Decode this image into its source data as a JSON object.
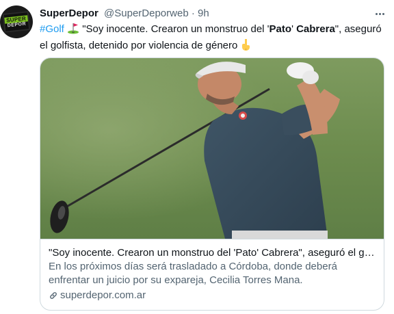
{
  "tweet": {
    "display_name": "SuperDepor",
    "handle": "@SuperDeporweb",
    "separator": "·",
    "time": "9h",
    "hashtag": "#Golf",
    "text_before_bold": " \"Soy inocente. Crearon un monstruo del '",
    "bold_1": "Pato",
    "text_between": "' ",
    "bold_2": "Cabrera",
    "text_after": "\", aseguró el golfista, detenido por violencia de género "
  },
  "avatar": {
    "logo_top": "SUPER",
    "logo_bottom": "DEPOR"
  },
  "card": {
    "title": "\"Soy inocente. Crearon un monstruo del 'Pato' Cabrera\", aseguró el golfista, detenido por violencia de género",
    "description": "En los próximos días será trasladado a Córdoba, donde deberá enfrentar un juicio por su expareja, Cecilia Torres Mana.",
    "domain": "superdepor.com.ar"
  },
  "icons": {
    "golf": "golf-flag-icon",
    "pointing": "backhand-index-pointing-down-icon",
    "more": "more-options-icon",
    "link": "link-icon"
  },
  "colors": {
    "accent": "#1d9bf0",
    "text_primary": "#0f1419",
    "text_secondary": "#536471",
    "border": "#cfd9de"
  }
}
